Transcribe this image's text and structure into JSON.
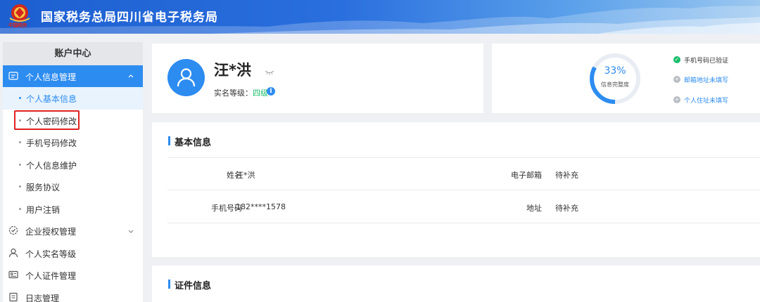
{
  "header": {
    "title": "国家税务总局四川省电子税务局",
    "logo_text": "中国税务",
    "logo_icon": "tax-emblem-icon"
  },
  "sidebar": {
    "title": "账户中心",
    "groups": [
      {
        "label": "个人信息管理",
        "icon": "profile-card-icon",
        "expanded": true,
        "items": [
          {
            "label": "个人基本信息",
            "active": true
          },
          {
            "label": "个人密码修改",
            "highlighted": true
          },
          {
            "label": "手机号码修改"
          },
          {
            "label": "个人信息维护"
          },
          {
            "label": "服务协议"
          },
          {
            "label": "用户注销"
          }
        ]
      },
      {
        "label": "企业授权管理",
        "icon": "gear-check-icon",
        "expandable": true
      },
      {
        "label": "个人实名等级",
        "icon": "user-icon"
      },
      {
        "label": "个人证件管理",
        "icon": "id-card-icon"
      },
      {
        "label": "日志管理",
        "icon": "log-icon"
      }
    ]
  },
  "profile": {
    "name": "汪*洪",
    "level_label": "实名等级：",
    "level_value": "四级"
  },
  "completeness": {
    "percent_text": "33%",
    "percent": 0.33,
    "label": "信息完整度",
    "checks": [
      {
        "text": "手机号码已验证",
        "status": "done"
      },
      {
        "text": "邮箱地址未填写",
        "status": "todo"
      },
      {
        "text": "个人住址未填写",
        "status": "todo"
      }
    ]
  },
  "basic_info": {
    "title": "基本信息",
    "name_label": "姓名",
    "name_value": "汪*洪",
    "email_label": "电子邮箱",
    "email_value": "待补充",
    "phone_label": "手机号码",
    "phone_value": "182****1578",
    "address_label": "地址",
    "address_value": "待补充"
  },
  "cert_info": {
    "title": "证件信息"
  },
  "colors": {
    "primary": "#2d8cf0",
    "success": "#19be6b",
    "highlight_border": "#e02020"
  }
}
